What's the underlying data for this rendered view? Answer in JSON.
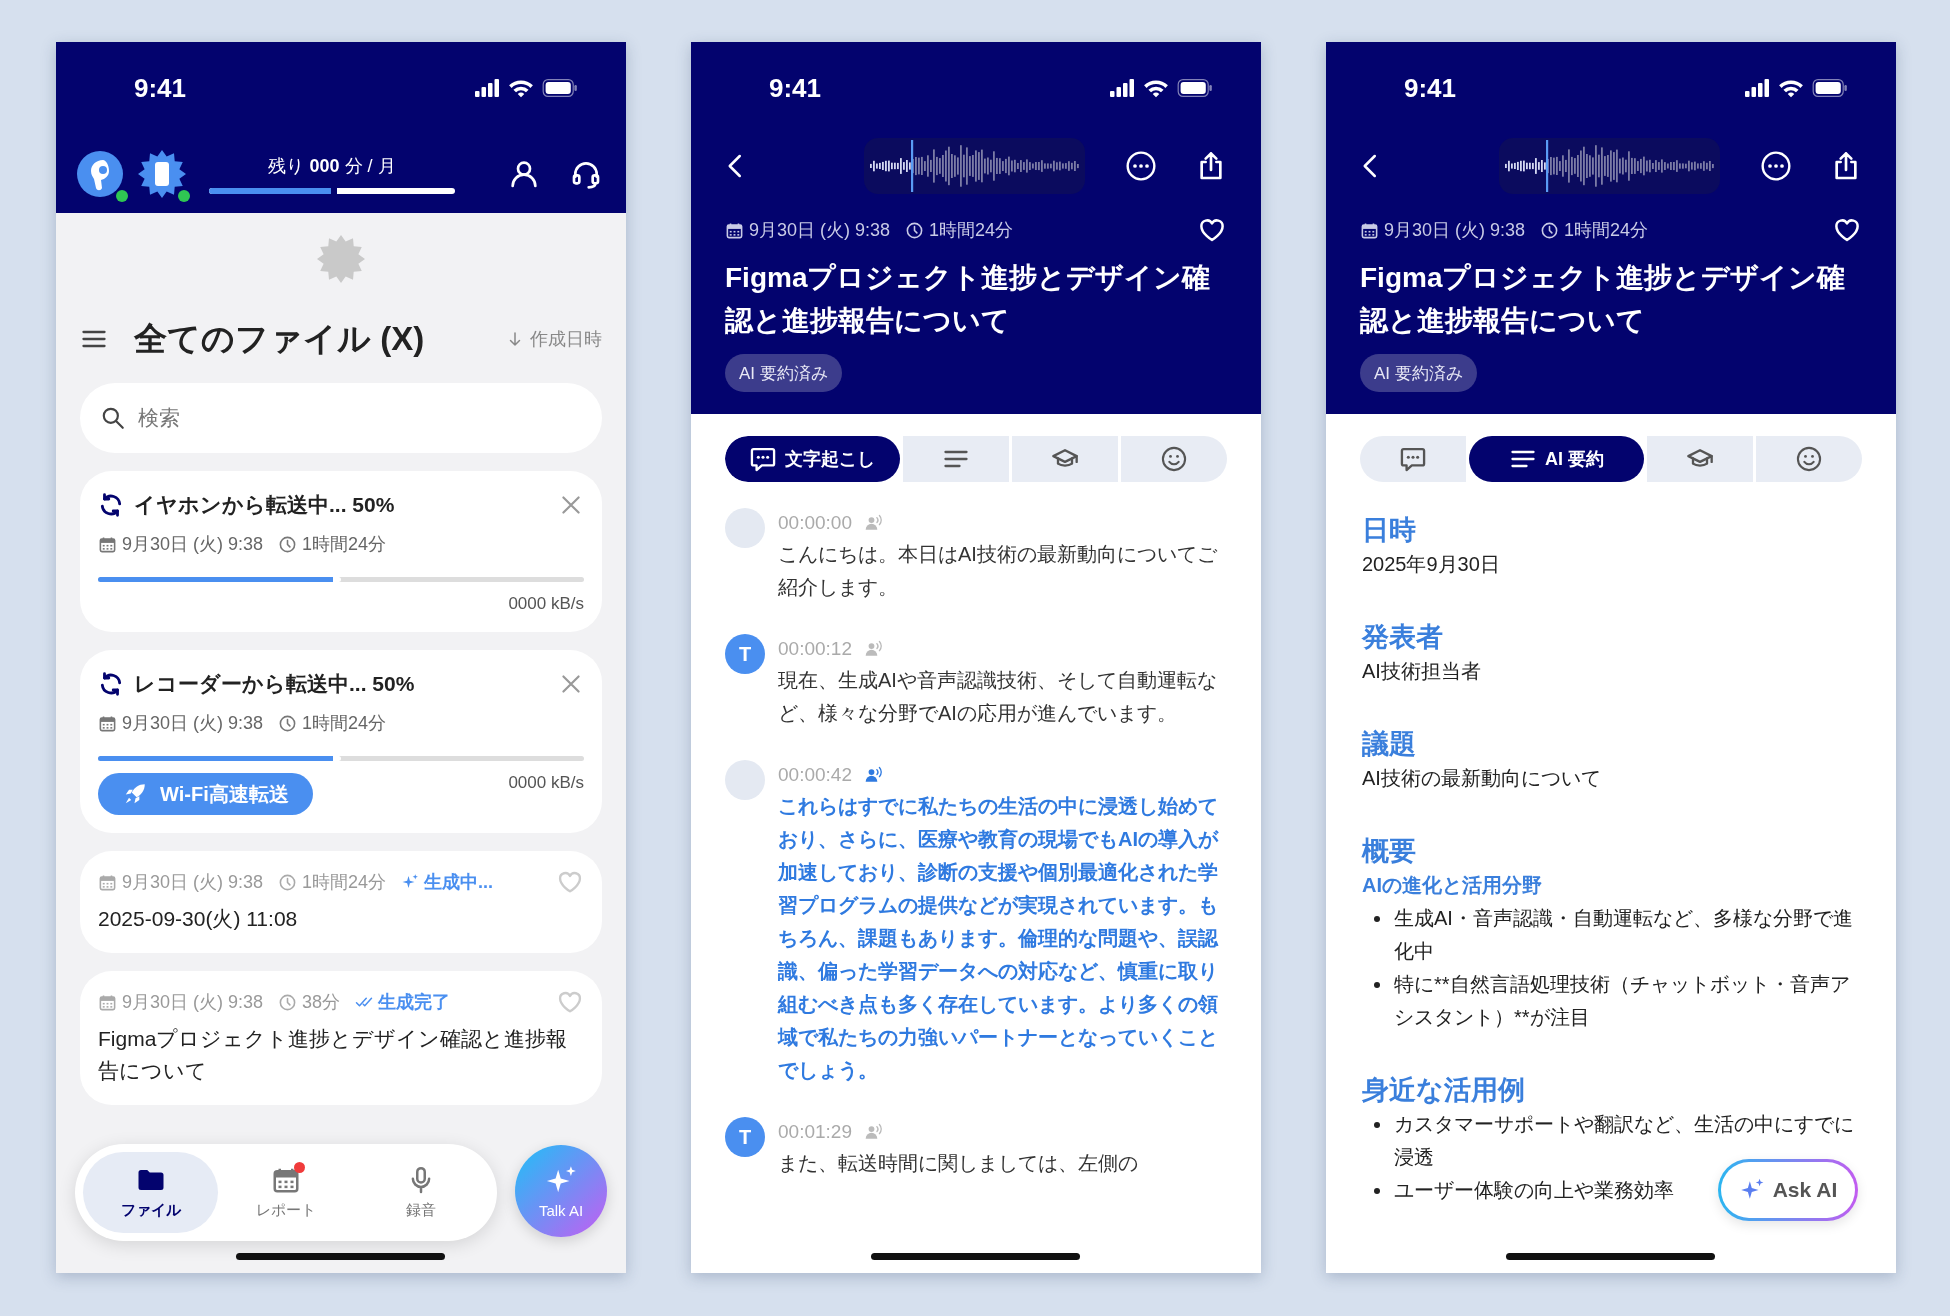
{
  "phones": [
    {
      "kind": "file_list",
      "status_bar": {
        "time": "9:41"
      },
      "devices": [
        {
          "kind": "earbuds",
          "connected": true
        },
        {
          "kind": "recorder",
          "connected": true
        }
      ],
      "quota": {
        "text": "残り **000** 分 / 月",
        "level": 0.52
      },
      "title": "全てのファイル (X)",
      "sort": "作成日時",
      "search": {
        "placeholder": "検索"
      },
      "cards": [
        {
          "kind": "transfer",
          "title": "イヤホンから転送中... 50%",
          "date": "9月30日 (火) 9:38",
          "duration": "1時間24分",
          "level": 0.5,
          "speed": "0000 kB/s"
        },
        {
          "kind": "transfer",
          "title": "レコーダーから転送中... 50%",
          "date": "9月30日 (火) 9:38",
          "duration": "1時間24分",
          "level": 0.5,
          "speed": "0000 kB/s",
          "button": "Wi-Fi高速転送"
        },
        {
          "kind": "file",
          "date": "9月30日 (火) 9:38",
          "duration": "1時間24分",
          "status": {
            "kind": "generating",
            "text": "生成中..."
          },
          "favorite": false,
          "title": "2025-09-30(火) 11:08"
        },
        {
          "kind": "file",
          "date": "9月30日 (火) 9:38",
          "duration": "38分",
          "status": {
            "kind": "done",
            "text": "生成完了"
          },
          "favorite": false,
          "title": "Figmaプロジェクト進捗とデザイン確認と進捗報告について"
        }
      ],
      "bottom_nav": [
        {
          "kind": "folder",
          "label": "ファイル",
          "selected": true,
          "badge": false
        },
        {
          "kind": "calendar",
          "label": "レポート",
          "selected": false,
          "badge": true
        },
        {
          "kind": "microphone",
          "label": "録音",
          "selected": false,
          "badge": false
        }
      ],
      "fab": {
        "label": "Talk AI"
      }
    },
    {
      "kind": "transcript",
      "status_bar": {
        "time": "9:41"
      },
      "recording": {
        "date": "9月30日 (火) 9:38",
        "duration": "1時間24分",
        "favorite": false,
        "title": "Figmaプロジェクト進捗とデザイン確認と進捗報告について",
        "tag": "AI 要約済み"
      },
      "tabs": [
        {
          "kind": "transcript",
          "label": "文字起こし",
          "selected": true
        },
        {
          "kind": "summary",
          "selected": false
        },
        {
          "kind": "learning",
          "selected": false
        },
        {
          "kind": "mood",
          "selected": false
        }
      ],
      "entries": [
        {
          "time": "00:00:00",
          "active": false,
          "text": "こんにちは。本日はAI技術の最新動向についてご紹介します。"
        },
        {
          "avatar": "T",
          "time": "00:00:12",
          "active": false,
          "text": "現在、生成AIや音声認識技術、そして自動運転など、様々な分野でAIの応用が進んでいます。"
        },
        {
          "time": "00:00:42",
          "active": true,
          "text": "これらはすでに私たちの生活の中に浸透し始めており、さらに、医療や教育の現場でもAIの導入が加速しており、診断の支援や個別最適化された学習プログラムの提供などが実現されています。もちろん、課題もあります。倫理的な問題や、誤認識、偏った学習データへの対応など、慎重に取り組むべき点も多く存在しています。より多くの領域で私たちの力強いパートナーとなっていくことでしょう。"
        },
        {
          "avatar": "T",
          "time": "00:01:29",
          "active": false,
          "text": "また、転送時間に関しましては、左側の"
        }
      ]
    },
    {
      "kind": "summary",
      "status_bar": {
        "time": "9:41"
      },
      "recording": {
        "date": "9月30日 (火) 9:38",
        "duration": "1時間24分",
        "favorite": false,
        "title": "Figmaプロジェクト進捗とデザイン確認と進捗報告について",
        "tag": "AI 要約済み"
      },
      "tabs": [
        {
          "kind": "transcript",
          "selected": false
        },
        {
          "kind": "summary",
          "label": "AI 要約",
          "selected": true
        },
        {
          "kind": "learning",
          "selected": false
        },
        {
          "kind": "mood",
          "selected": false
        }
      ],
      "sections": [
        {
          "heading": "日時",
          "body": "2025年9月30日"
        },
        {
          "heading": "発表者",
          "body": "AI技術担当者"
        },
        {
          "heading": "議題",
          "body": "AI技術の最新動向について"
        },
        {
          "heading": "概要",
          "subheading": "AIの進化と活用分野",
          "bullets": [
            "生成AI・音声認識・自動運転など、多様な分野で進化中",
            "特に**自然言語処理技術（チャットボット・音声アシスタント）**が注目"
          ]
        },
        {
          "heading": "身近な活用例",
          "bullets": [
            "カスタマーサポートや翻訳など、生活の中にすでに浸透",
            "ユーザー体験の向上や業務効率"
          ]
        }
      ],
      "ask_ai": {
        "label": "Ask AI"
      }
    }
  ]
}
